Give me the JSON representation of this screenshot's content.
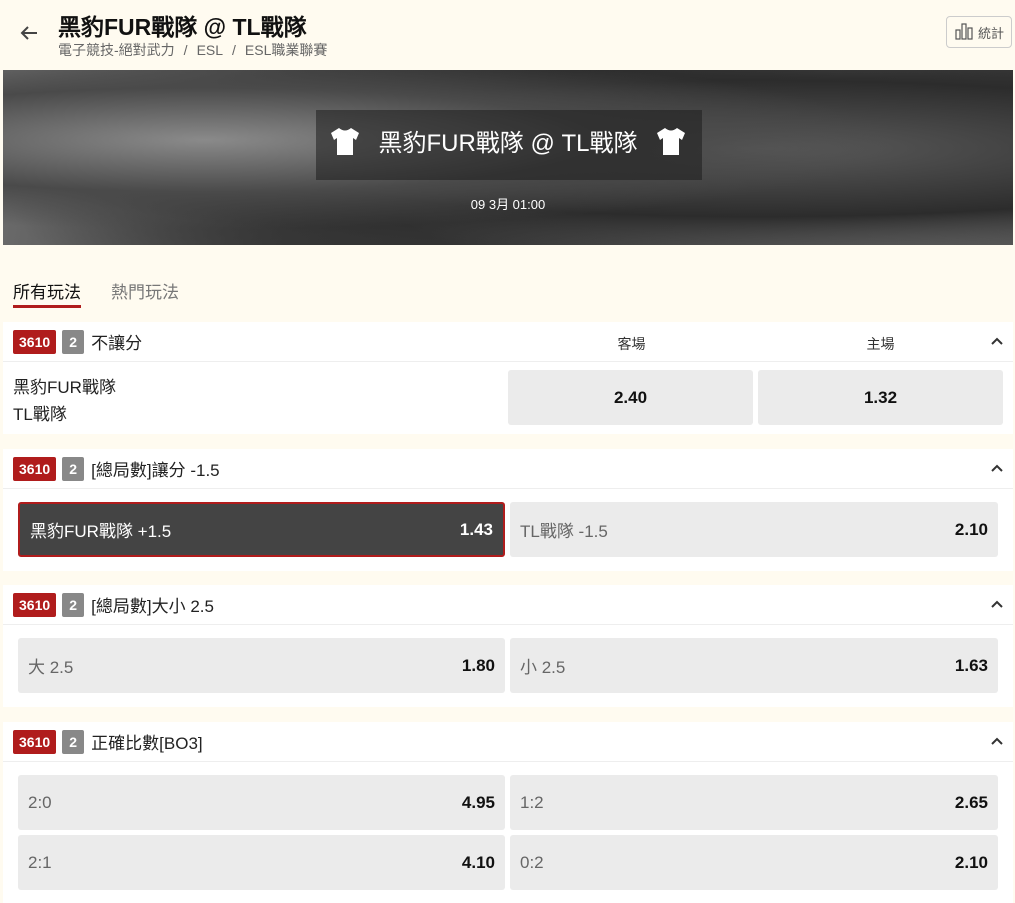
{
  "header": {
    "title": "黑豹FUR戰隊 @ TL戰隊",
    "breadcrumb": [
      "電子競技-絕對武力",
      "ESL",
      "ESL職業聯賽"
    ],
    "breadcrumb_sep": "/",
    "stats_label": "統計"
  },
  "banner": {
    "title": "黑豹FUR戰隊 @ TL戰隊",
    "date": "09 3月 01:00"
  },
  "tabs": [
    {
      "label": "所有玩法",
      "active": true
    },
    {
      "label": "熱門玩法",
      "active": false
    }
  ],
  "markets": [
    {
      "id": "3610",
      "count": "2",
      "name": "不讓分",
      "col_away": "客場",
      "col_home": "主場",
      "teams": [
        "黑豹FUR戰隊",
        "TL戰隊"
      ],
      "odds": [
        "2.40",
        "1.32"
      ]
    },
    {
      "id": "3610",
      "count": "2",
      "name": "[總局數]讓分 -1.5",
      "selections": [
        {
          "label": "黑豹FUR戰隊 +1.5",
          "odds": "1.43",
          "selected": true
        },
        {
          "label": "TL戰隊 -1.5",
          "odds": "2.10",
          "selected": false
        }
      ]
    },
    {
      "id": "3610",
      "count": "2",
      "name": "[總局數]大小 2.5",
      "selections": [
        {
          "label": "大 2.5",
          "odds": "1.80"
        },
        {
          "label": "小 2.5",
          "odds": "1.63"
        }
      ]
    },
    {
      "id": "3610",
      "count": "2",
      "name": "正確比數[BO3]",
      "selections": [
        {
          "label": "2:0",
          "odds": "4.95"
        },
        {
          "label": "1:2",
          "odds": "2.65"
        },
        {
          "label": "2:1",
          "odds": "4.10"
        },
        {
          "label": "0:2",
          "odds": "2.10"
        }
      ]
    }
  ],
  "colors": {
    "accent": "#b01c1c",
    "background": "#fffbf0",
    "button": "#ebebeb",
    "selected": "#444444"
  }
}
